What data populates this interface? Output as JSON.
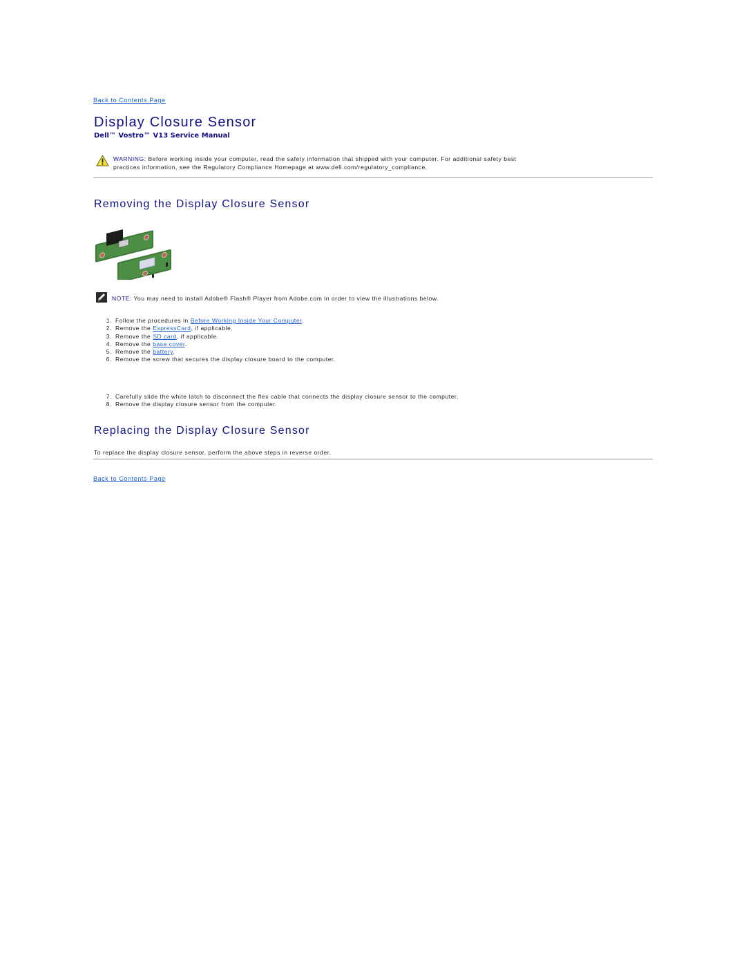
{
  "nav": {
    "back_top": "Back to Contents Page",
    "back_bottom": "Back to Contents Page"
  },
  "header": {
    "title": "Display Closure Sensor",
    "subtitle": "Dell™ Vostro™ V13 Service Manual"
  },
  "warning": {
    "icon": "warning-triangle-icon",
    "label": "WARNING:",
    "line1": " Before working inside your computer, read the safety information that shipped with your computer. For additional safety best",
    "line2": "practices information, see the Regulatory Compliance Homepage at www.dell.com/regulatory_compliance."
  },
  "removing": {
    "heading": "Removing the Display Closure Sensor",
    "image_alt": "display closure sensor boards",
    "note": {
      "icon": "note-pencil-icon",
      "label": "NOTE:",
      "text": " You may need to install Adobe® Flash® Player from Adobe.com in order to view the illustrations below."
    },
    "steps_a": [
      {
        "num": "1.",
        "pre": "Follow the procedures in ",
        "link": "Before Working Inside Your Computer",
        "post": "."
      },
      {
        "num": "2.",
        "pre": "Remove the ",
        "link": "ExpressCard",
        "post": ", if applicable."
      },
      {
        "num": "3.",
        "pre": "Remove the ",
        "link": "SD card",
        "post": ", if applicable."
      },
      {
        "num": "4.",
        "pre": "Remove the ",
        "link": "base cover",
        "post": "."
      },
      {
        "num": "5.",
        "pre": "Remove the ",
        "link": "battery",
        "post": "."
      },
      {
        "num": "6.",
        "pre": "Remove the screw that secures the display closure board to the computer.",
        "link": "",
        "post": ""
      }
    ],
    "steps_b": [
      {
        "num": "7.",
        "text": "Carefully slide the white latch to disconnect the flex cable that connects the display closure sensor to the computer."
      },
      {
        "num": "8.",
        "text": "Remove the display closure sensor from the computer."
      }
    ]
  },
  "replacing": {
    "heading": "Replacing the Display Closure Sensor",
    "text": "To replace the display closure sensor, perform the above steps in reverse order."
  }
}
